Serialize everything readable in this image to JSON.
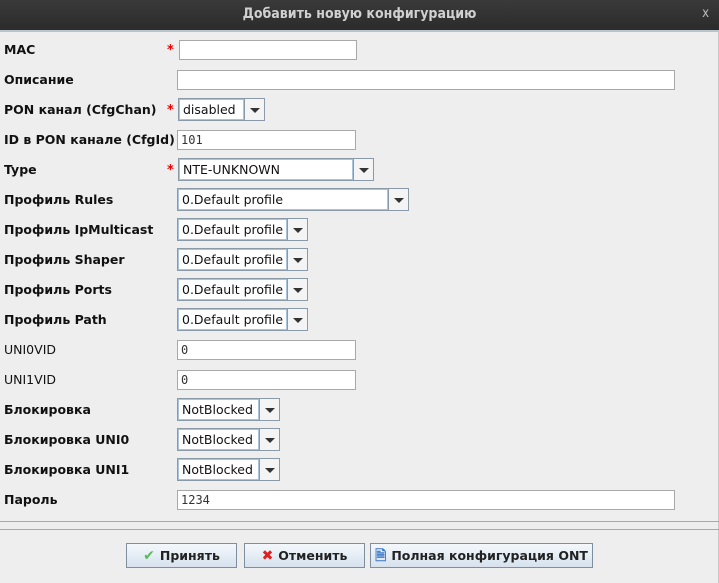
{
  "window": {
    "title": "Добавить новую конфигурацию",
    "close": "x"
  },
  "fields": {
    "mac": {
      "label": "MAC",
      "value": ""
    },
    "description": {
      "label": "Описание",
      "value": ""
    },
    "pon_channel": {
      "label": "PON канал (CfgChan)",
      "value": "disabled"
    },
    "pon_id": {
      "label": "ID в PON канале (CfgId)",
      "value": "101"
    },
    "type": {
      "label": "Type",
      "value": "NTE-UNKNOWN"
    },
    "profile_rules": {
      "label": "Профиль Rules",
      "value": "0.Default profile"
    },
    "profile_ipmulticast": {
      "label": "Профиль IpMulticast",
      "value": "0.Default profile"
    },
    "profile_shaper": {
      "label": "Профиль Shaper",
      "value": "0.Default profile"
    },
    "profile_ports": {
      "label": "Профиль Ports",
      "value": "0.Default profile"
    },
    "profile_path": {
      "label": "Профиль Path",
      "value": "0.Default profile"
    },
    "uni0vid": {
      "label": "UNI0VID",
      "value": "0"
    },
    "uni1vid": {
      "label": "UNI1VID",
      "value": "0"
    },
    "block": {
      "label": "Блокировка",
      "value": "NotBlocked"
    },
    "block_uni0": {
      "label": "Блокировка UNI0",
      "value": "NotBlocked"
    },
    "block_uni1": {
      "label": "Блокировка UNI1",
      "value": "NotBlocked"
    },
    "password": {
      "label": "Пароль",
      "value": "1234"
    }
  },
  "required_mark": "*",
  "buttons": {
    "accept": "Принять",
    "cancel": "Отменить",
    "full_config": "Полная конфигурация ONT"
  }
}
